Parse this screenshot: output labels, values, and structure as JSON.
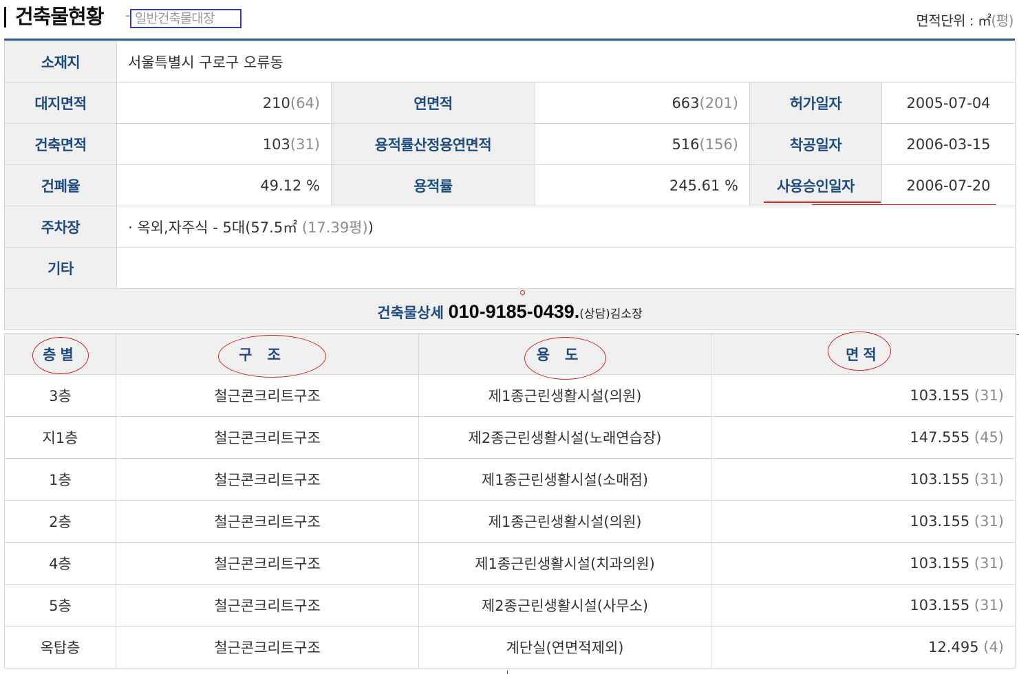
{
  "header": {
    "title": "건축물현황",
    "dash": "-",
    "subtitle": "일반건축물대장",
    "unit_label": "면적단위 : ㎡",
    "unit_secondary": "(평)"
  },
  "info": {
    "location": {
      "label": "소재지",
      "value": "서울특별시 구로구 오류동"
    },
    "land_area": {
      "label": "대지면적",
      "value": "210",
      "pyeong": "(64)"
    },
    "total_floor_area": {
      "label": "연면적",
      "value": "663",
      "pyeong": "(201)"
    },
    "permit_date": {
      "label": "허가일자",
      "value": "2005-07-04"
    },
    "building_area": {
      "label": "건축면적",
      "value": "103",
      "pyeong": "(31)"
    },
    "far_floor_area": {
      "label": "용적률산정용연면적",
      "value": "516",
      "pyeong": "(156)"
    },
    "start_date": {
      "label": "착공일자",
      "value": "2006-03-15"
    },
    "coverage_ratio": {
      "label": "건폐율",
      "value": "49.12 %"
    },
    "floor_area_ratio": {
      "label": "용적률",
      "value": "245.61 %"
    },
    "approval_date": {
      "label": "사용승인일자",
      "value": "2006-07-20"
    },
    "parking": {
      "label": "주차장",
      "value": "· 옥외,자주식 - 5대(57.5㎡",
      "pyeong": "(17.39평)",
      "close": ")"
    },
    "other": {
      "label": "기타",
      "value": ""
    }
  },
  "detail": {
    "label": "건축물상세",
    "phone": "010-9185-0439.",
    "note": "(상담)김소장"
  },
  "floors": {
    "headers": [
      "층별",
      "구조",
      "용도",
      "면적"
    ],
    "rows": [
      {
        "floor": "3층",
        "structure": "철근콘크리트구조",
        "use": "제1종근린생활시설(의원)",
        "area": "103.155",
        "pyeong": "(31)"
      },
      {
        "floor": "지1층",
        "structure": "철근콘크리트구조",
        "use": "제2종근린생활시설(노래연습장)",
        "area": "147.555",
        "pyeong": "(45)"
      },
      {
        "floor": "1층",
        "structure": "철근콘크리트구조",
        "use": "제1종근린생활시설(소매점)",
        "area": "103.155",
        "pyeong": "(31)"
      },
      {
        "floor": "2층",
        "structure": "철근콘크리트구조",
        "use": "제1종근린생활시설(의원)",
        "area": "103.155",
        "pyeong": "(31)"
      },
      {
        "floor": "4층",
        "structure": "철근콘크리트구조",
        "use": "제1종근린생활시설(치과의원)",
        "area": "103.155",
        "pyeong": "(31)"
      },
      {
        "floor": "5층",
        "structure": "철근콘크리트구조",
        "use": "제2종근린생활시설(사무소)",
        "area": "103.155",
        "pyeong": "(31)"
      },
      {
        "floor": "옥탑층",
        "structure": "철근콘크리트구조",
        "use": "계단실(연면적제외)",
        "area": "12.495",
        "pyeong": "(4)"
      }
    ]
  },
  "colors": {
    "label_text": "#1e4b7e",
    "label_bg": "#efefef",
    "accent_line": "#2e5c8a",
    "annotation_red": "#d42020",
    "subtitle_border": "#3333cc"
  }
}
